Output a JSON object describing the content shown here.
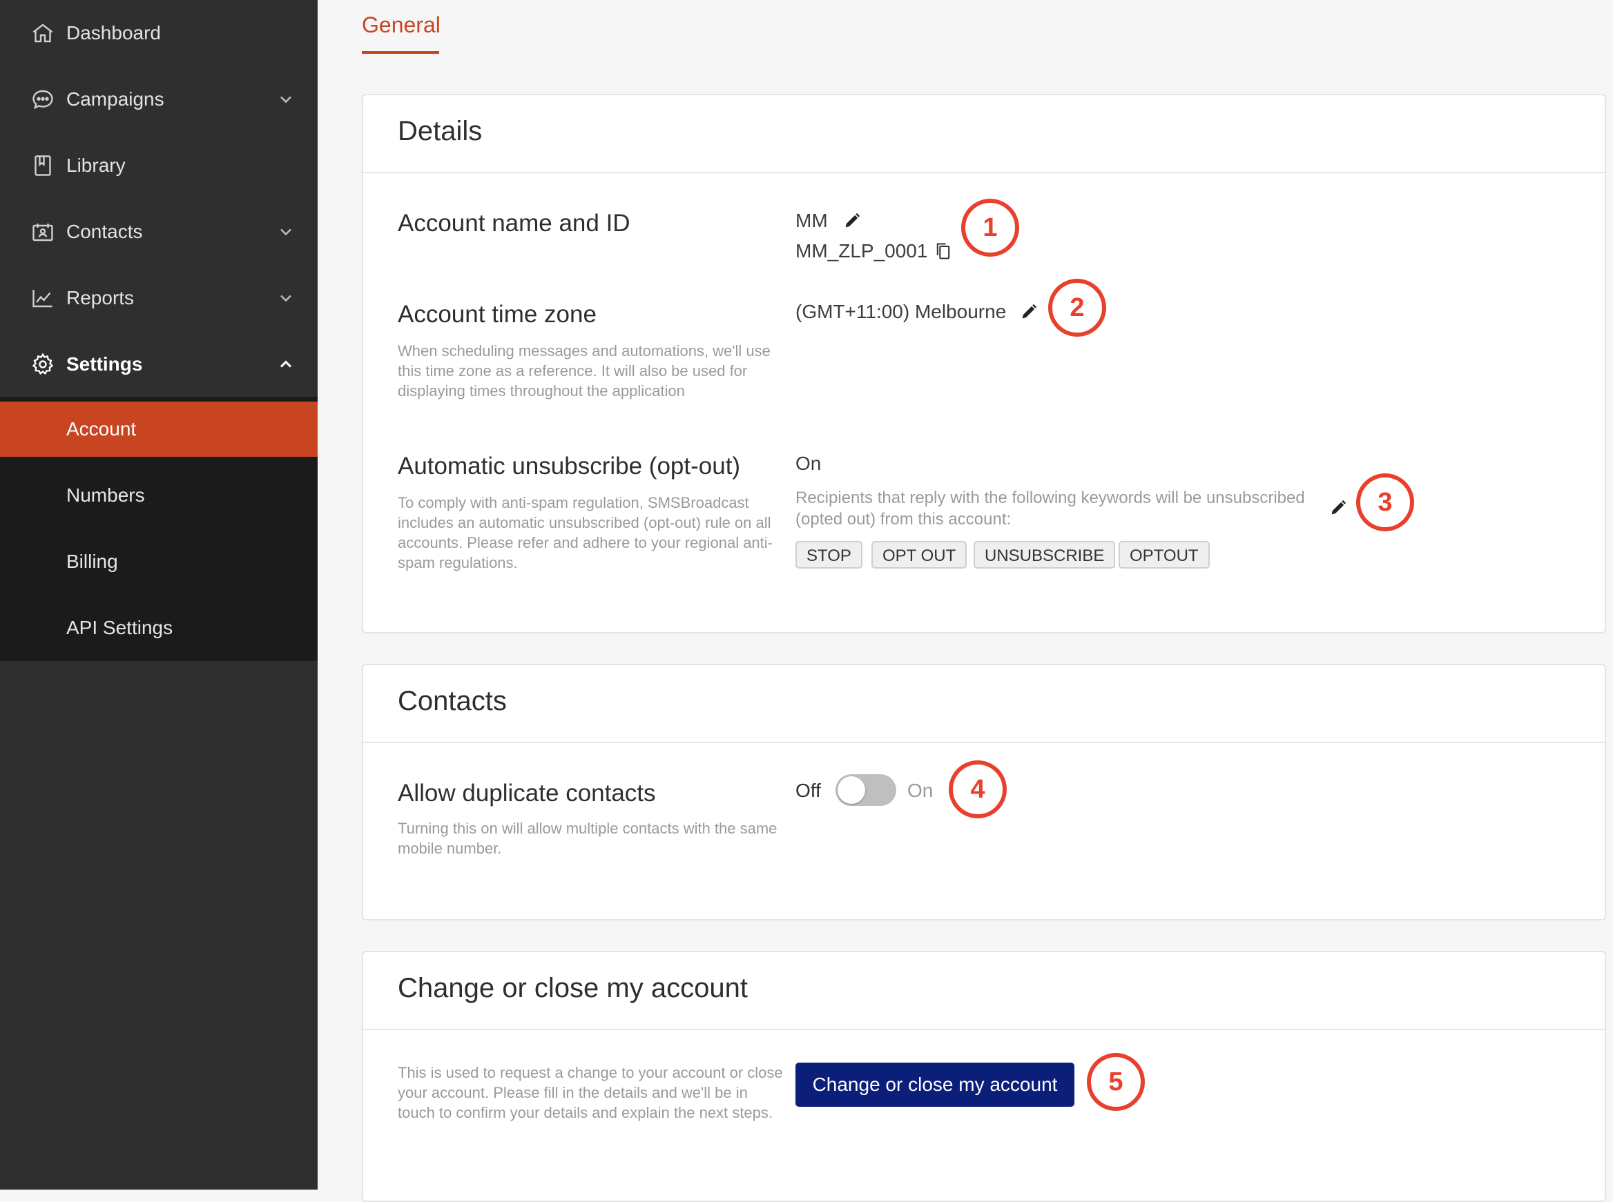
{
  "sidebar": {
    "items": [
      {
        "label": "Dashboard",
        "icon": "home-icon"
      },
      {
        "label": "Campaigns",
        "icon": "chat-bubble-icon"
      },
      {
        "label": "Library",
        "icon": "book-icon"
      },
      {
        "label": "Contacts",
        "icon": "contact-card-icon"
      },
      {
        "label": "Reports",
        "icon": "line-chart-icon"
      },
      {
        "label": "Settings",
        "icon": "gear-icon"
      }
    ],
    "sub_items": [
      {
        "label": "Account"
      },
      {
        "label": "Numbers"
      },
      {
        "label": "Billing"
      },
      {
        "label": "API Settings"
      }
    ]
  },
  "tabs": {
    "general": "General"
  },
  "details": {
    "title": "Details",
    "account_name_label": "Account name and ID",
    "account_name": "MM",
    "account_id": "MM_ZLP_0001",
    "timezone_label": "Account time zone",
    "timezone_desc": "When scheduling messages and automations, we'll use this time zone as a reference. It will also be used for displaying times throughout the application",
    "timezone_value": "(GMT+11:00) Melbourne",
    "optout_label": "Automatic unsubscribe (opt-out)",
    "optout_desc": "To comply with anti-spam regulation, SMSBroadcast includes an automatic unsubscribed (opt-out) rule on all accounts. Please refer and adhere to your regional anti-spam regulations.",
    "optout_status": "On",
    "optout_info": "Recipients that reply with the following keywords will be unsubscribed (opted out) from this account:",
    "keywords": [
      "STOP",
      "OPT OUT",
      "UNSUBSCRIBE",
      "OPTOUT"
    ]
  },
  "contacts": {
    "title": "Contacts",
    "duplicates_label": "Allow duplicate contacts",
    "duplicates_desc": "Turning this on will allow multiple contacts with the same mobile number.",
    "toggle_off_label": "Off",
    "toggle_on_label": "On",
    "toggle_state": "off"
  },
  "close_account": {
    "title": "Change or close my account",
    "desc": "This is used to request a change to your account or close your account. Please fill in the details and we'll be in touch to confirm your details and explain the next steps.",
    "button_label": "Change or close my account"
  },
  "callouts": [
    "1",
    "2",
    "3",
    "4",
    "5"
  ],
  "colors": {
    "accent": "#c94521",
    "sidebar_bg": "#2f2f2f",
    "subnav_bg": "#1b1b1b",
    "primary_button": "#0b1f7a",
    "callout": "#e8402d"
  }
}
